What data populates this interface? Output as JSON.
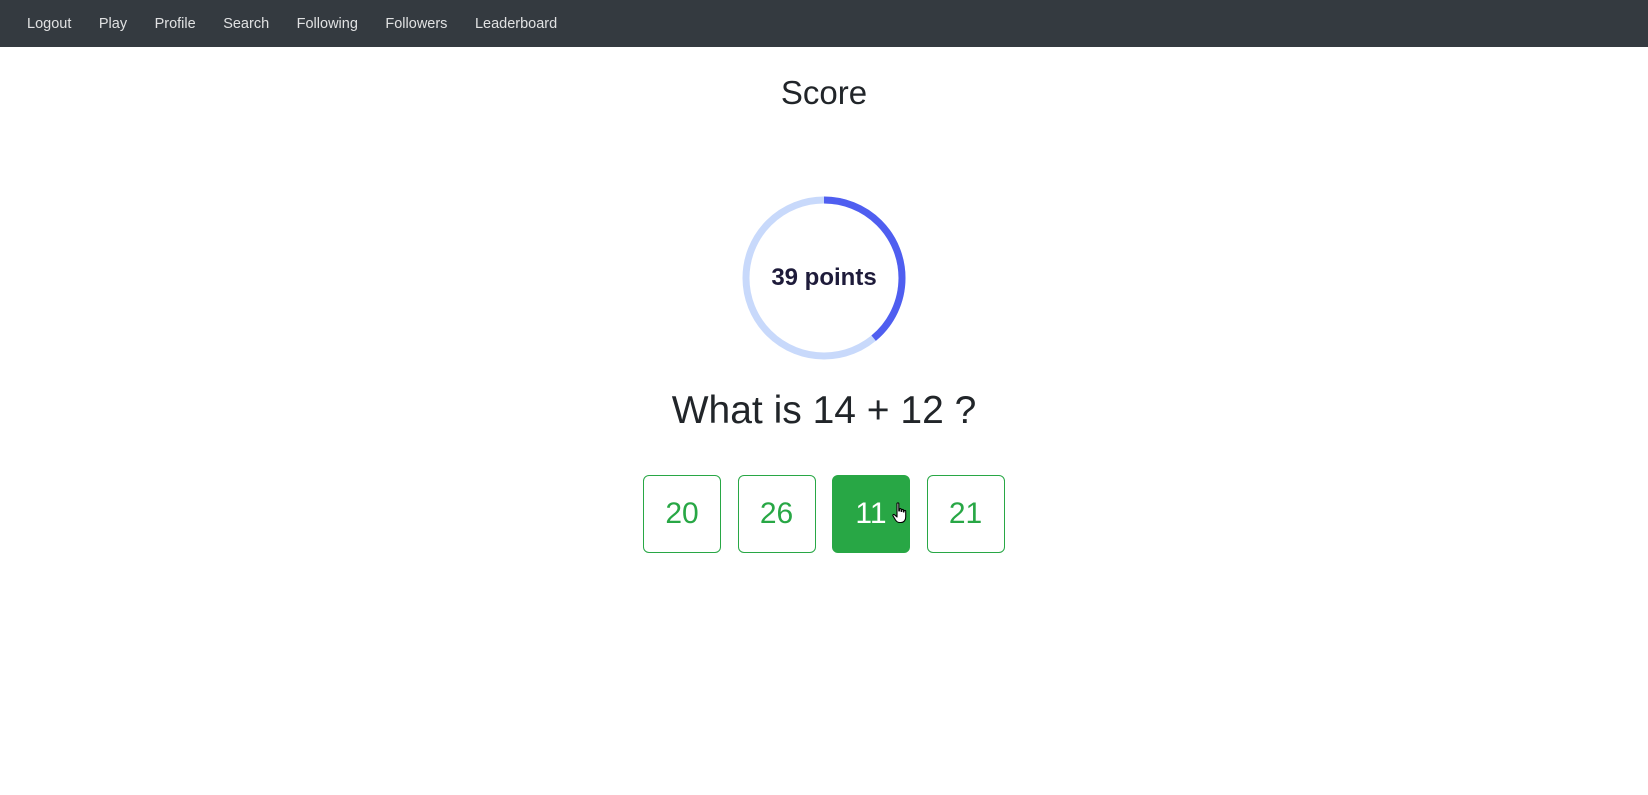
{
  "nav": {
    "items": [
      {
        "label": "Logout"
      },
      {
        "label": "Play"
      },
      {
        "label": "Profile"
      },
      {
        "label": "Search"
      },
      {
        "label": "Following"
      },
      {
        "label": "Followers"
      },
      {
        "label": "Leaderboard"
      }
    ]
  },
  "page": {
    "title": "Score"
  },
  "score": {
    "label": "39 points",
    "progress_fraction": 0.39,
    "track_color": "#c8d9fb",
    "fill_color": "#4f5ef0"
  },
  "question": {
    "text": "What is 14 + 12 ?"
  },
  "answers": [
    {
      "label": "20",
      "selected": false
    },
    {
      "label": "26",
      "selected": false
    },
    {
      "label": "11",
      "selected": true
    },
    {
      "label": "21",
      "selected": false
    }
  ],
  "colors": {
    "navbar_bg": "#343a40",
    "accent_green": "#28a745"
  },
  "icons": {
    "cursor": "hand-pointer-cursor-icon"
  }
}
